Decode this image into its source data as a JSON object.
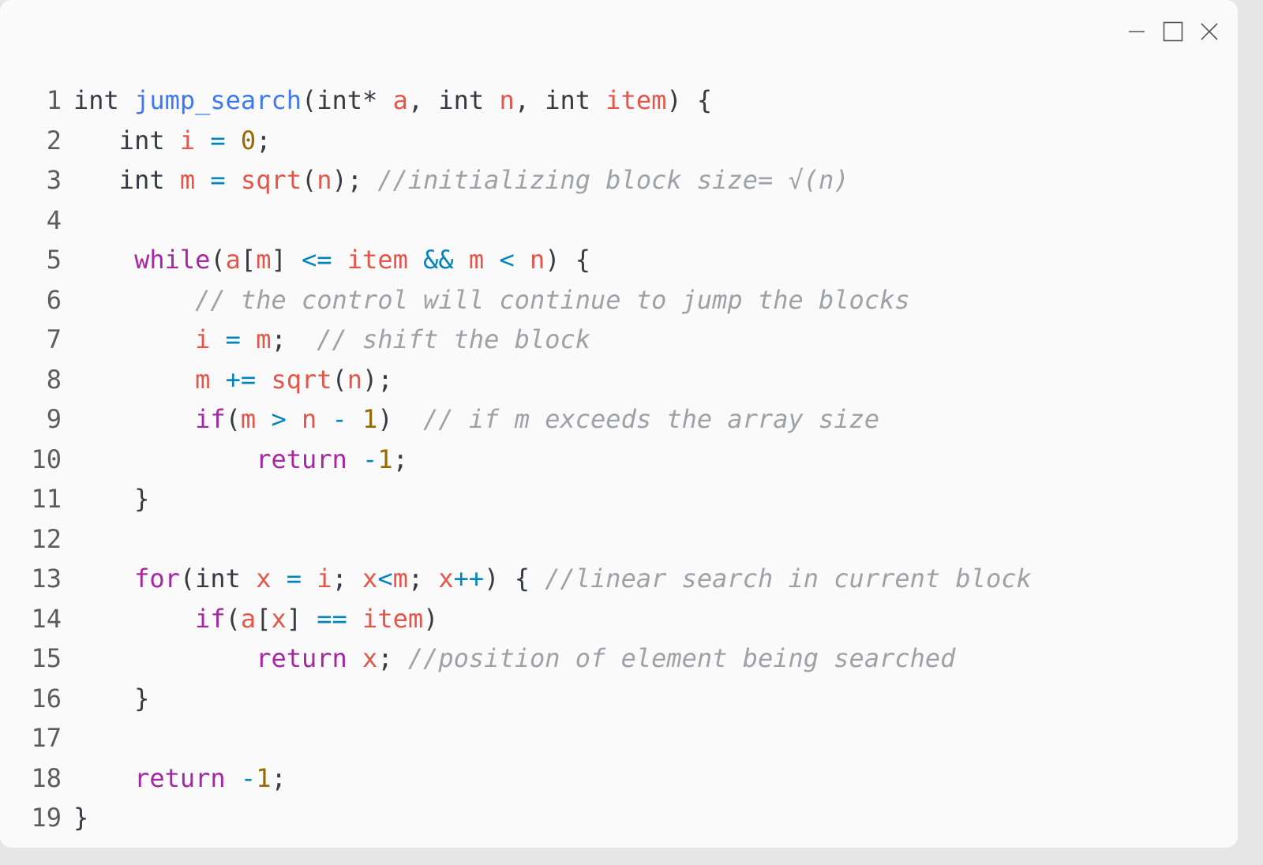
{
  "window": {
    "controls": {
      "minimize_icon": "minimize-icon",
      "maximize_icon": "maximize-icon",
      "close_icon": "close-icon"
    }
  },
  "editor": {
    "language": "c",
    "colors": {
      "background": "#fafafa",
      "keyword_type": "#383a42",
      "keyword": "#a626a4",
      "function": "#4078f2",
      "variable": "#e45649",
      "operator": "#0184bc",
      "number": "#986801",
      "comment": "#a0a1a7",
      "line_number": "#5c5c5c"
    },
    "lines": [
      {
        "num": "1",
        "tokens": [
          {
            "t": "int",
            "c": "kw-type"
          },
          {
            "t": " ",
            "c": "pl"
          },
          {
            "t": "jump_search",
            "c": "fn"
          },
          {
            "t": "(",
            "c": "pl"
          },
          {
            "t": "int*",
            "c": "kw-type"
          },
          {
            "t": " ",
            "c": "pl"
          },
          {
            "t": "a",
            "c": "var"
          },
          {
            "t": ", ",
            "c": "pl"
          },
          {
            "t": "int",
            "c": "kw-type"
          },
          {
            "t": " ",
            "c": "pl"
          },
          {
            "t": "n",
            "c": "var"
          },
          {
            "t": ", ",
            "c": "pl"
          },
          {
            "t": "int",
            "c": "kw-type"
          },
          {
            "t": " ",
            "c": "pl"
          },
          {
            "t": "item",
            "c": "var"
          },
          {
            "t": ") {",
            "c": "pl"
          }
        ]
      },
      {
        "num": "2",
        "tokens": [
          {
            "t": "   ",
            "c": "pl"
          },
          {
            "t": "int",
            "c": "kw-type"
          },
          {
            "t": " ",
            "c": "pl"
          },
          {
            "t": "i",
            "c": "var"
          },
          {
            "t": " ",
            "c": "pl"
          },
          {
            "t": "=",
            "c": "op"
          },
          {
            "t": " ",
            "c": "pl"
          },
          {
            "t": "0",
            "c": "num"
          },
          {
            "t": ";",
            "c": "pl"
          }
        ]
      },
      {
        "num": "3",
        "tokens": [
          {
            "t": "   ",
            "c": "pl"
          },
          {
            "t": "int",
            "c": "kw-type"
          },
          {
            "t": " ",
            "c": "pl"
          },
          {
            "t": "m",
            "c": "var"
          },
          {
            "t": " ",
            "c": "pl"
          },
          {
            "t": "=",
            "c": "op"
          },
          {
            "t": " ",
            "c": "pl"
          },
          {
            "t": "sqrt",
            "c": "var"
          },
          {
            "t": "(",
            "c": "pl"
          },
          {
            "t": "n",
            "c": "var"
          },
          {
            "t": "); ",
            "c": "pl"
          },
          {
            "t": "//initializing block size= √(n)",
            "c": "cm"
          }
        ]
      },
      {
        "num": "4",
        "tokens": []
      },
      {
        "num": "5",
        "tokens": [
          {
            "t": "    ",
            "c": "pl"
          },
          {
            "t": "while",
            "c": "kw"
          },
          {
            "t": "(",
            "c": "pl"
          },
          {
            "t": "a",
            "c": "var"
          },
          {
            "t": "[",
            "c": "pl"
          },
          {
            "t": "m",
            "c": "var"
          },
          {
            "t": "] ",
            "c": "pl"
          },
          {
            "t": "<=",
            "c": "op"
          },
          {
            "t": " ",
            "c": "pl"
          },
          {
            "t": "item",
            "c": "var"
          },
          {
            "t": " ",
            "c": "pl"
          },
          {
            "t": "&&",
            "c": "op"
          },
          {
            "t": " ",
            "c": "pl"
          },
          {
            "t": "m",
            "c": "var"
          },
          {
            "t": " ",
            "c": "pl"
          },
          {
            "t": "<",
            "c": "op"
          },
          {
            "t": " ",
            "c": "pl"
          },
          {
            "t": "n",
            "c": "var"
          },
          {
            "t": ") {",
            "c": "pl"
          }
        ]
      },
      {
        "num": "6",
        "tokens": [
          {
            "t": "        ",
            "c": "pl"
          },
          {
            "t": "// the control will continue to jump the blocks",
            "c": "cm"
          }
        ]
      },
      {
        "num": "7",
        "tokens": [
          {
            "t": "        ",
            "c": "pl"
          },
          {
            "t": "i",
            "c": "var"
          },
          {
            "t": " ",
            "c": "pl"
          },
          {
            "t": "=",
            "c": "op"
          },
          {
            "t": " ",
            "c": "pl"
          },
          {
            "t": "m",
            "c": "var"
          },
          {
            "t": ";  ",
            "c": "pl"
          },
          {
            "t": "// shift the block",
            "c": "cm"
          }
        ]
      },
      {
        "num": "8",
        "tokens": [
          {
            "t": "        ",
            "c": "pl"
          },
          {
            "t": "m",
            "c": "var"
          },
          {
            "t": " ",
            "c": "pl"
          },
          {
            "t": "+=",
            "c": "op"
          },
          {
            "t": " ",
            "c": "pl"
          },
          {
            "t": "sqrt",
            "c": "var"
          },
          {
            "t": "(",
            "c": "pl"
          },
          {
            "t": "n",
            "c": "var"
          },
          {
            "t": ");",
            "c": "pl"
          }
        ]
      },
      {
        "num": "9",
        "tokens": [
          {
            "t": "        ",
            "c": "pl"
          },
          {
            "t": "if",
            "c": "kw"
          },
          {
            "t": "(",
            "c": "pl"
          },
          {
            "t": "m",
            "c": "var"
          },
          {
            "t": " ",
            "c": "pl"
          },
          {
            "t": ">",
            "c": "op"
          },
          {
            "t": " ",
            "c": "pl"
          },
          {
            "t": "n",
            "c": "var"
          },
          {
            "t": " ",
            "c": "pl"
          },
          {
            "t": "-",
            "c": "op"
          },
          {
            "t": " ",
            "c": "pl"
          },
          {
            "t": "1",
            "c": "num"
          },
          {
            "t": ")  ",
            "c": "pl"
          },
          {
            "t": "// if m exceeds the array size",
            "c": "cm"
          }
        ]
      },
      {
        "num": "10",
        "tokens": [
          {
            "t": "            ",
            "c": "pl"
          },
          {
            "t": "return",
            "c": "kw"
          },
          {
            "t": " ",
            "c": "pl"
          },
          {
            "t": "-",
            "c": "op"
          },
          {
            "t": "1",
            "c": "num"
          },
          {
            "t": ";",
            "c": "pl"
          }
        ]
      },
      {
        "num": "11",
        "tokens": [
          {
            "t": "    }",
            "c": "pl"
          }
        ]
      },
      {
        "num": "12",
        "tokens": []
      },
      {
        "num": "13",
        "tokens": [
          {
            "t": "    ",
            "c": "pl"
          },
          {
            "t": "for",
            "c": "kw"
          },
          {
            "t": "(",
            "c": "pl"
          },
          {
            "t": "int",
            "c": "kw-type"
          },
          {
            "t": " ",
            "c": "pl"
          },
          {
            "t": "x",
            "c": "var"
          },
          {
            "t": " ",
            "c": "pl"
          },
          {
            "t": "=",
            "c": "op"
          },
          {
            "t": " ",
            "c": "pl"
          },
          {
            "t": "i",
            "c": "var"
          },
          {
            "t": "; ",
            "c": "pl"
          },
          {
            "t": "x",
            "c": "var"
          },
          {
            "t": "<",
            "c": "op"
          },
          {
            "t": "m",
            "c": "var"
          },
          {
            "t": "; ",
            "c": "pl"
          },
          {
            "t": "x",
            "c": "var"
          },
          {
            "t": "++",
            "c": "op"
          },
          {
            "t": ") { ",
            "c": "pl"
          },
          {
            "t": "//linear search in current block",
            "c": "cm"
          }
        ]
      },
      {
        "num": "14",
        "tokens": [
          {
            "t": "        ",
            "c": "pl"
          },
          {
            "t": "if",
            "c": "kw"
          },
          {
            "t": "(",
            "c": "pl"
          },
          {
            "t": "a",
            "c": "var"
          },
          {
            "t": "[",
            "c": "pl"
          },
          {
            "t": "x",
            "c": "var"
          },
          {
            "t": "] ",
            "c": "pl"
          },
          {
            "t": "==",
            "c": "op"
          },
          {
            "t": " ",
            "c": "pl"
          },
          {
            "t": "item",
            "c": "var"
          },
          {
            "t": ")",
            "c": "pl"
          }
        ]
      },
      {
        "num": "15",
        "tokens": [
          {
            "t": "            ",
            "c": "pl"
          },
          {
            "t": "return",
            "c": "kw"
          },
          {
            "t": " ",
            "c": "pl"
          },
          {
            "t": "x",
            "c": "var"
          },
          {
            "t": "; ",
            "c": "pl"
          },
          {
            "t": "//position of element being searched",
            "c": "cm"
          }
        ]
      },
      {
        "num": "16",
        "tokens": [
          {
            "t": "    }",
            "c": "pl"
          }
        ]
      },
      {
        "num": "17",
        "tokens": []
      },
      {
        "num": "18",
        "tokens": [
          {
            "t": "    ",
            "c": "pl"
          },
          {
            "t": "return",
            "c": "kw"
          },
          {
            "t": " ",
            "c": "pl"
          },
          {
            "t": "-",
            "c": "op"
          },
          {
            "t": "1",
            "c": "num"
          },
          {
            "t": ";",
            "c": "pl"
          }
        ]
      },
      {
        "num": "19",
        "tokens": [
          {
            "t": "}",
            "c": "pl"
          }
        ]
      }
    ]
  }
}
